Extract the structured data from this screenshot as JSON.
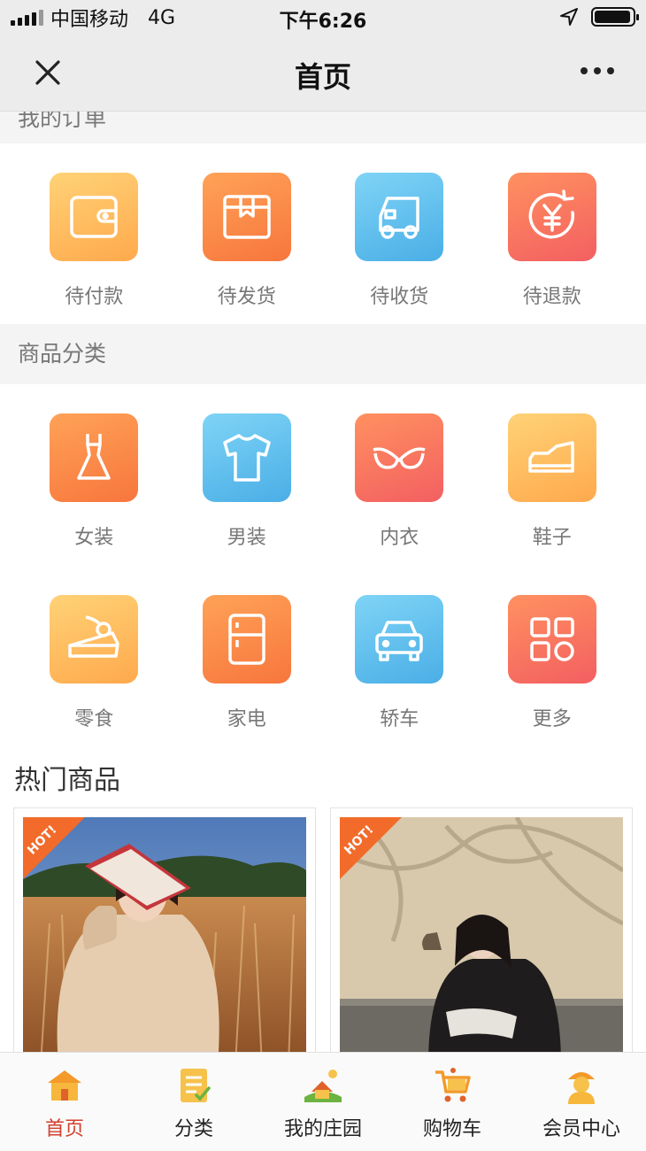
{
  "status_bar": {
    "carrier": "中国移动",
    "network": "4G",
    "time": "下午6:26",
    "battery_level": 0.95
  },
  "nav": {
    "title": "首页",
    "close_icon": "close-icon",
    "more_icon": "more-icon"
  },
  "orders": {
    "header": "我的订单",
    "items": [
      {
        "label": "待付款",
        "icon": "wallet-icon",
        "color": "#ffb94f"
      },
      {
        "label": "待发货",
        "icon": "package-icon",
        "color": "#f98a46"
      },
      {
        "label": "待收货",
        "icon": "truck-icon",
        "color": "#5fc0ee"
      },
      {
        "label": "待退款",
        "icon": "refund-yen-icon",
        "color": "#f6725d"
      }
    ]
  },
  "categories": {
    "header": "商品分类",
    "items": [
      {
        "label": "女装",
        "icon": "dress-icon",
        "color": "#f98a46"
      },
      {
        "label": "男装",
        "icon": "tshirt-icon",
        "color": "#5fc0ee"
      },
      {
        "label": "内衣",
        "icon": "bra-icon",
        "color": "#f6725d"
      },
      {
        "label": "鞋子",
        "icon": "shoe-icon",
        "color": "#ffb94f"
      },
      {
        "label": "零食",
        "icon": "cake-icon",
        "color": "#ffb94f"
      },
      {
        "label": "家电",
        "icon": "fridge-icon",
        "color": "#f98a46"
      },
      {
        "label": "轿车",
        "icon": "car-icon",
        "color": "#5fc0ee"
      },
      {
        "label": "更多",
        "icon": "more-grid-icon",
        "color": "#f6725d"
      }
    ]
  },
  "hot": {
    "title": "热门商品",
    "badge": "HOT!",
    "products": [
      {
        "image": "product-photo-girl-with-book"
      },
      {
        "image": "product-photo-girl-leather-jacket"
      }
    ]
  },
  "tab_bar": {
    "items": [
      {
        "label": "首页",
        "icon": "home-icon",
        "active": true
      },
      {
        "label": "分类",
        "icon": "category-list-icon",
        "active": false
      },
      {
        "label": "我的庄园",
        "icon": "farm-icon",
        "active": false
      },
      {
        "label": "购物车",
        "icon": "cart-icon",
        "active": false
      },
      {
        "label": "会员中心",
        "icon": "member-icon",
        "active": false
      }
    ],
    "active_color": "#d2402f"
  }
}
